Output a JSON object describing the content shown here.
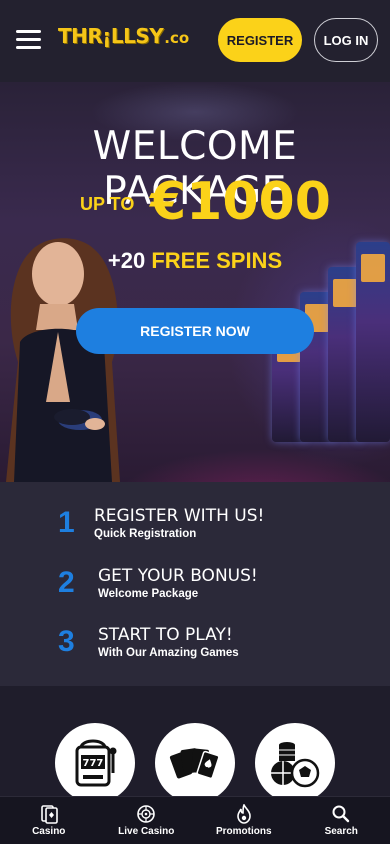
{
  "header": {
    "logo_main": "THR¡LLSY",
    "logo_sub": ".co",
    "register_label": "REGISTER",
    "login_label": "LOG IN"
  },
  "hero": {
    "title": "WELCOME PACKAGE",
    "upto": "UP TO",
    "amount": "€1000",
    "spins_plus": "+20",
    "spins_free": "FREE SPINS",
    "cta_label": "REGISTER NOW"
  },
  "steps": [
    {
      "num": "1",
      "title": "REGISTER WITH US!",
      "subtitle": "Quick Registration"
    },
    {
      "num": "2",
      "title": "GET YOUR BONUS!",
      "subtitle": "Welcome Package"
    },
    {
      "num": "3",
      "title": "START TO PLAY!",
      "subtitle": "With Our Amazing Games"
    }
  ],
  "categories": [
    {
      "icon": "slot-machine-icon"
    },
    {
      "icon": "playing-cards-icon"
    },
    {
      "icon": "sports-chips-icon"
    }
  ],
  "bottom_nav": [
    {
      "label": "Casino",
      "icon": "cards-icon"
    },
    {
      "label": "Live Casino",
      "icon": "roulette-icon"
    },
    {
      "label": "Promotions",
      "icon": "flame-icon"
    },
    {
      "label": "Search",
      "icon": "search-icon"
    }
  ],
  "colors": {
    "accent_yellow": "#fbd219",
    "accent_blue": "#1e7fe0",
    "background": "#1f1d2b"
  }
}
